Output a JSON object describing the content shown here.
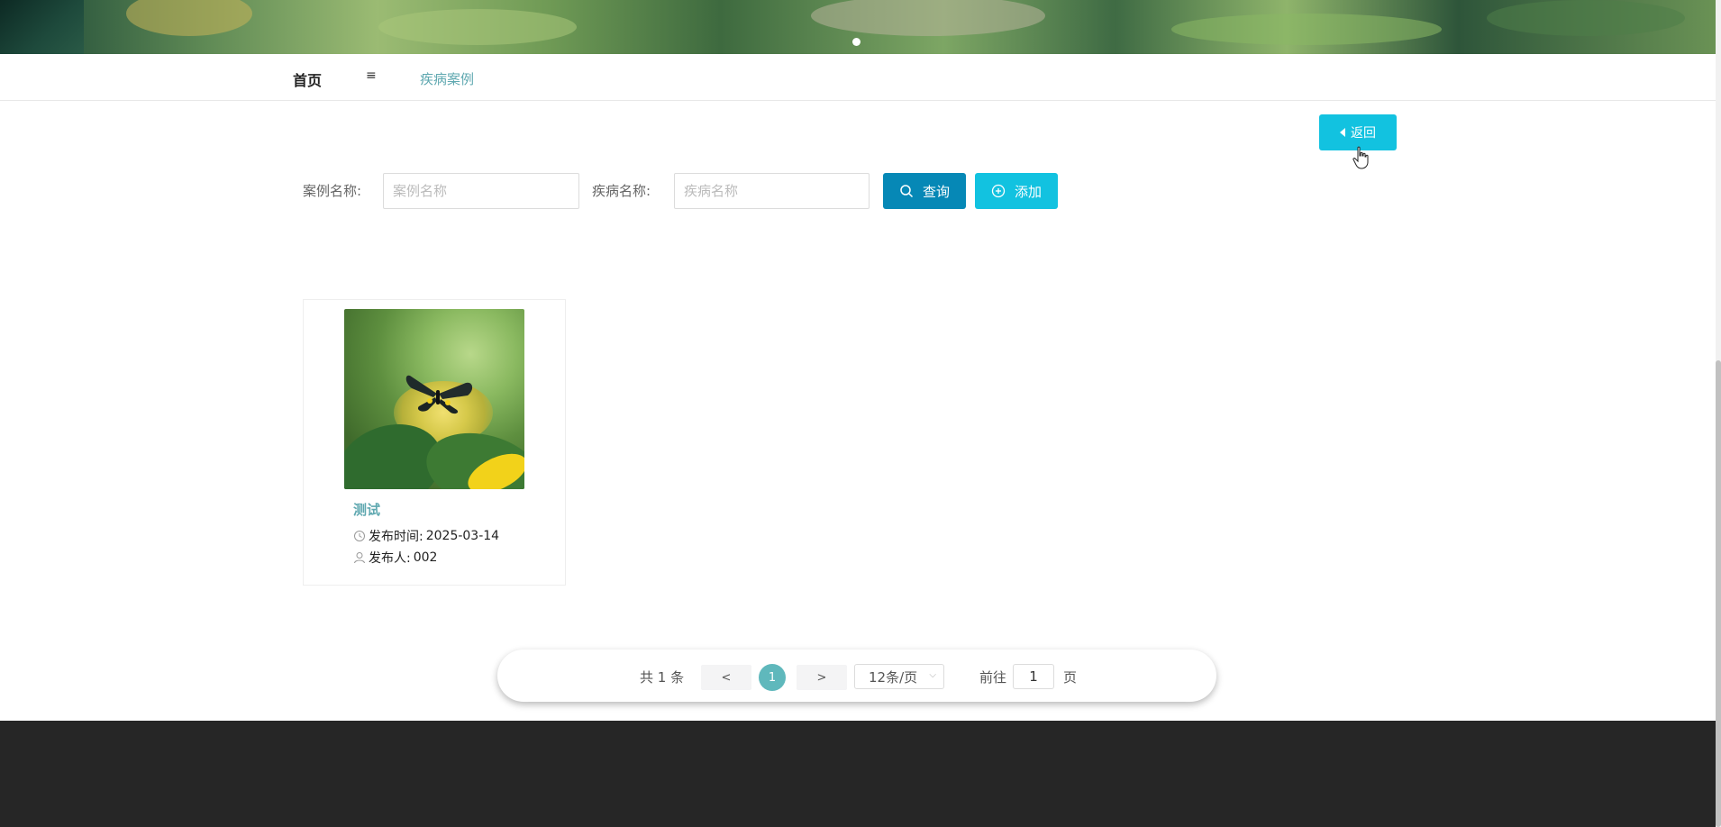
{
  "nav": {
    "home": "首页",
    "menu_icon": "≡",
    "breadcrumb": "疾病案例"
  },
  "back_button": {
    "label": "返回",
    "icon": "caret-left-icon"
  },
  "search": {
    "case_name_label": "案例名称:",
    "case_name_placeholder": "案例名称",
    "case_name_value": "",
    "disease_name_label": "疾病名称:",
    "disease_name_placeholder": "疾病名称",
    "disease_name_value": "",
    "query_label": "查询",
    "add_label": "添加"
  },
  "cards": [
    {
      "title": "测试",
      "publish_time_label": "发布时间:",
      "publish_time": "2025-03-14",
      "publisher_label": "发布人:",
      "publisher": "002"
    }
  ],
  "pagination": {
    "total": "共 1 条",
    "prev": "<",
    "current": "1",
    "next": ">",
    "page_size": "12条/页",
    "goto_label": "前往",
    "goto_value": "1",
    "page_unit": "页"
  },
  "colors": {
    "accent": "#12c2e0",
    "primary": "#0688b6",
    "link": "#5fa8b0",
    "footer": "#262626"
  }
}
